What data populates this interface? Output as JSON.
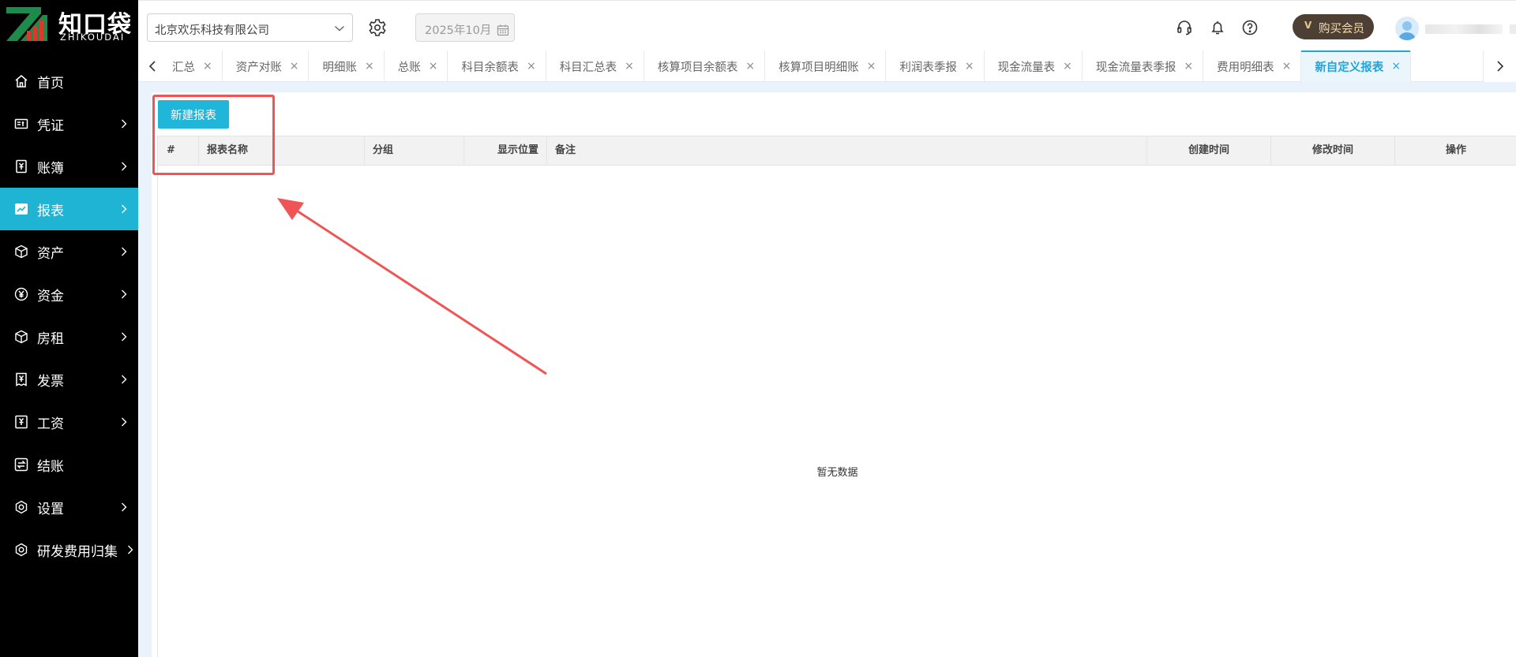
{
  "brand": {
    "name_cn": "知口袋",
    "name_en": "ZHIKOUDAI",
    "colors": {
      "green": "#1e8a4c",
      "red": "#d83a2b"
    }
  },
  "sidebar": {
    "items": [
      {
        "label": "首页",
        "icon": "home-icon",
        "has_arrow": false
      },
      {
        "label": "凭证",
        "icon": "voucher-icon",
        "has_arrow": true
      },
      {
        "label": "账簿",
        "icon": "ledger-icon",
        "has_arrow": true
      },
      {
        "label": "报表",
        "icon": "report-icon",
        "has_arrow": true,
        "active": true
      },
      {
        "label": "资产",
        "icon": "cube-icon",
        "has_arrow": true
      },
      {
        "label": "资金",
        "icon": "yuan-coin-icon",
        "has_arrow": true
      },
      {
        "label": "房租",
        "icon": "cube-icon",
        "has_arrow": true
      },
      {
        "label": "发票",
        "icon": "invoice-icon",
        "has_arrow": true
      },
      {
        "label": "工资",
        "icon": "salary-icon",
        "has_arrow": true
      },
      {
        "label": "结账",
        "icon": "settle-icon",
        "has_arrow": false
      },
      {
        "label": "设置",
        "icon": "gear-icon",
        "has_arrow": true
      },
      {
        "label": "研发费用归集",
        "icon": "gear-icon",
        "has_arrow": true
      }
    ],
    "colors": {
      "background": "#000000",
      "active": "#1fb3d4"
    }
  },
  "header": {
    "company": "北京欢乐科技有限公司",
    "period": "2025年10月",
    "vip_badge": "V",
    "vip_label": "购买会员",
    "icons": [
      "headset-icon",
      "bell-icon",
      "help-icon"
    ]
  },
  "tabs": {
    "items": [
      {
        "label": "汇总",
        "display": "汇总"
      },
      {
        "label": "资产对账"
      },
      {
        "label": "明细账"
      },
      {
        "label": "总账"
      },
      {
        "label": "科目余额表"
      },
      {
        "label": "科目汇总表"
      },
      {
        "label": "核算项目余额表"
      },
      {
        "label": "核算项目明细账"
      },
      {
        "label": "利润表季报"
      },
      {
        "label": "现金流量表"
      },
      {
        "label": "现金流量表季报"
      },
      {
        "label": "费用明细表"
      },
      {
        "label": "新自定义报表",
        "active": true
      }
    ],
    "close_glyph": "×"
  },
  "main": {
    "new_button": "新建报表",
    "table": {
      "columns": [
        "#",
        "报表名称",
        "分组",
        "显示位置",
        "备注",
        "创建时间",
        "修改时间",
        "操作"
      ],
      "rows": [],
      "empty_text": "暂无数据"
    }
  },
  "annotation": {
    "color": "#f05454"
  }
}
